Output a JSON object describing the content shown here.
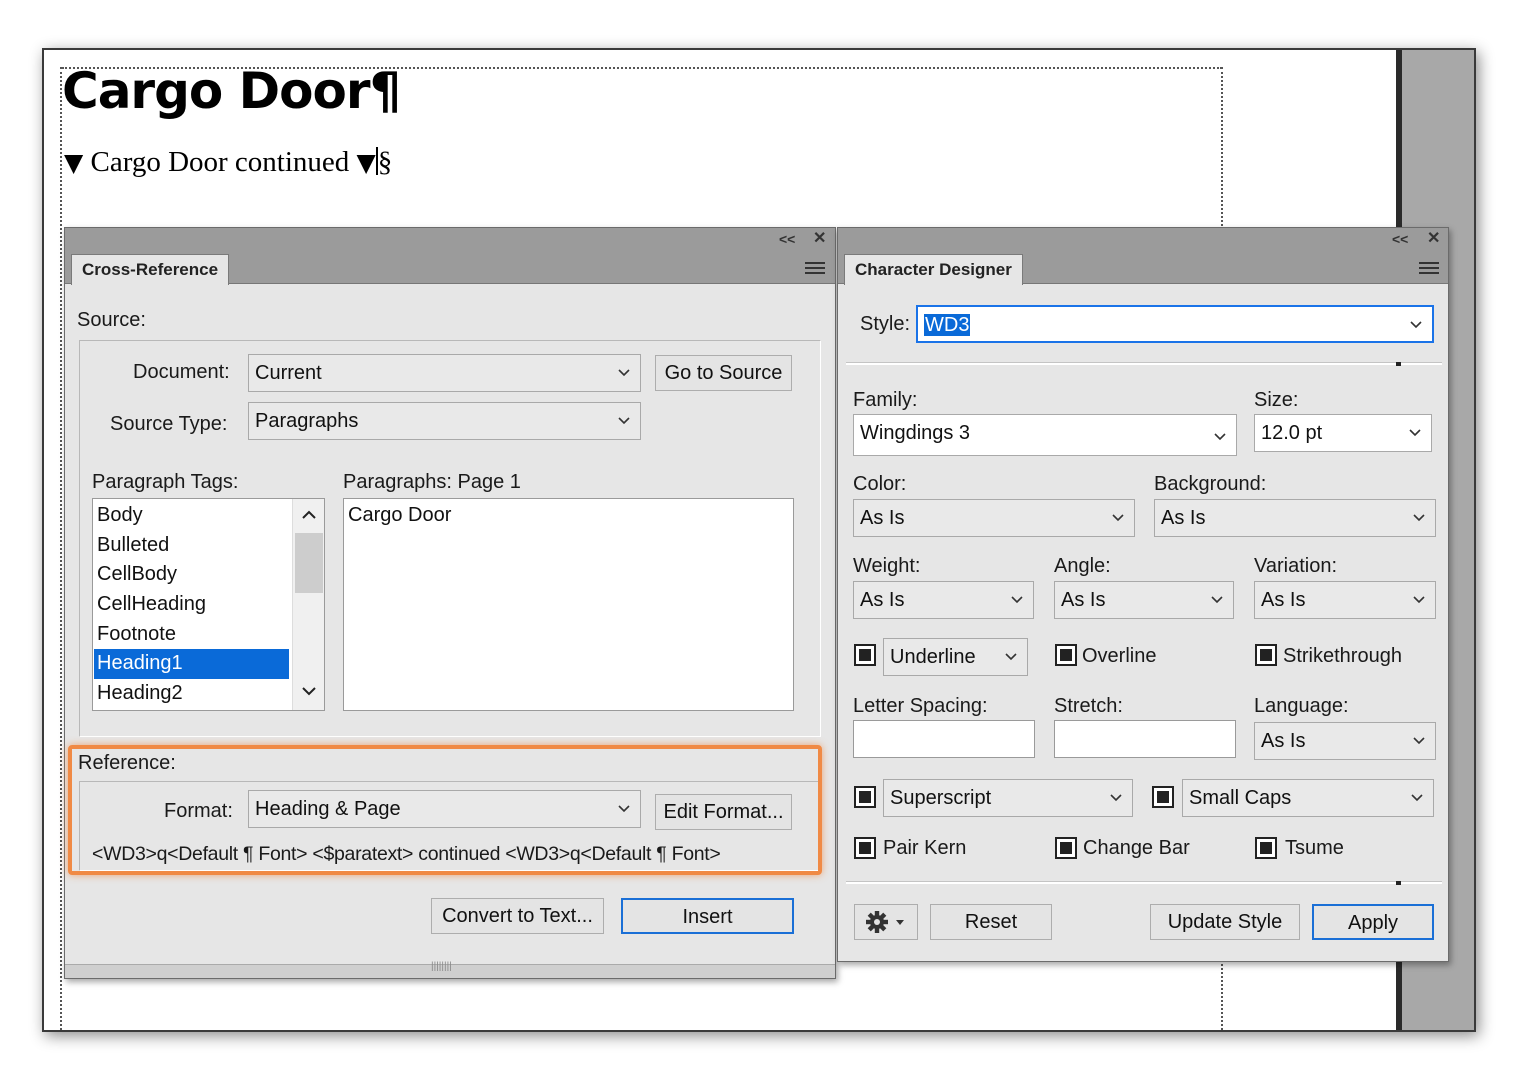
{
  "document": {
    "heading": "Cargo Door¶",
    "continued_line": {
      "marker_left": "▼",
      "text": "Cargo Door continued",
      "marker_right": "▼",
      "section_mark": "§"
    }
  },
  "cross_reference": {
    "tab_label": "Cross-Reference",
    "titlebar_collapse": "<<",
    "titlebar_close": "✕",
    "source_label": "Source:",
    "document_label": "Document:",
    "document_value": "Current",
    "go_to_source": "Go to Source",
    "source_type_label": "Source Type:",
    "source_type_value": "Paragraphs",
    "paragraph_tags_label": "Paragraph Tags:",
    "paragraph_tags": [
      "Body",
      "Bulleted",
      "CellBody",
      "CellHeading",
      "Footnote",
      "Heading1",
      "Heading2"
    ],
    "selected_tag": "Heading1",
    "paragraphs_label": "Paragraphs: Page  1",
    "paragraphs": [
      "Cargo Door"
    ],
    "reference_label": "Reference:",
    "format_label": "Format:",
    "format_value": "Heading & Page",
    "edit_format": "Edit Format...",
    "format_definition": "<WD3>q<Default ¶ Font> <$paratext> continued <WD3>q<Default ¶ Font>",
    "convert_to_text": "Convert to Text...",
    "insert": "Insert",
    "resize_grip": "||||||||"
  },
  "character_designer": {
    "tab_label": "Character Designer",
    "titlebar_collapse": "<<",
    "titlebar_close": "✕",
    "style_label": "Style:",
    "style_value": "WD3",
    "family_label": "Family:",
    "family_value": "Wingdings 3",
    "size_label": "Size:",
    "size_value": "12.0 pt",
    "color_label": "Color:",
    "color_value": "As Is",
    "background_label": "Background:",
    "background_value": "As Is",
    "weight_label": "Weight:",
    "weight_value": "As Is",
    "angle_label": "Angle:",
    "angle_value": "As Is",
    "variation_label": "Variation:",
    "variation_value": "As Is",
    "underline_value": "Underline",
    "overline": "Overline",
    "strikethrough": "Strikethrough",
    "letter_spacing_label": "Letter Spacing:",
    "letter_spacing_value": "",
    "stretch_label": "Stretch:",
    "stretch_value": "",
    "language_label": "Language:",
    "language_value": "As Is",
    "superscript_value": "Superscript",
    "small_caps_value": "Small Caps",
    "pair_kern": "Pair Kern",
    "change_bar": "Change Bar",
    "tsume": "Tsume",
    "gear_icon": "gear-icon",
    "reset": "Reset",
    "update_style": "Update Style",
    "apply": "Apply"
  },
  "colors": {
    "selection": "#0a6ad8",
    "highlight": "#f08a45",
    "panel_bg": "#e6e6e6",
    "panel_header": "#9b9b9b"
  }
}
